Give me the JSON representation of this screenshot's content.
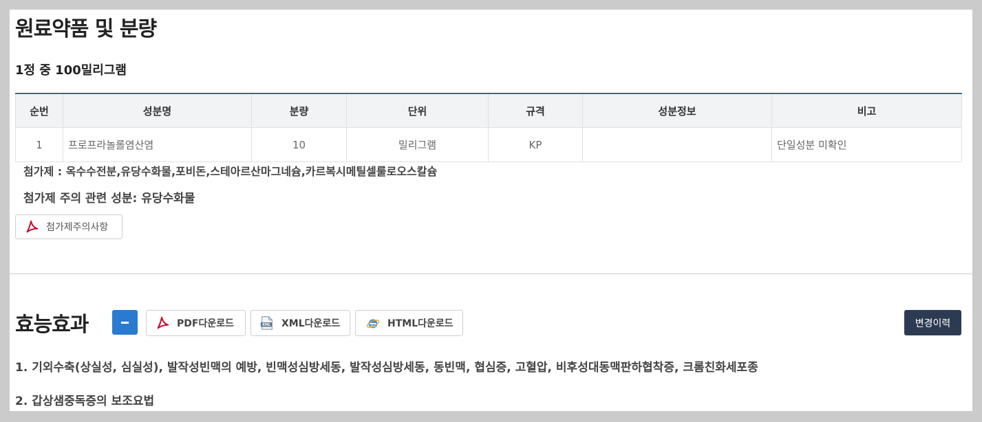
{
  "ingredients": {
    "title": "원료약품 및 분량",
    "subtitle": "1정 중 100밀리그램",
    "headers": [
      "순번",
      "성분명",
      "분량",
      "단위",
      "규격",
      "성분정보",
      "비고"
    ],
    "rows": [
      [
        "1",
        "프로프라놀롤염산염",
        "10",
        "밀리그램",
        "KP",
        "",
        "단일성분 미확인"
      ]
    ],
    "additives": "첨가제 : 옥수수전분,유당수화물,포비돈,스테아르산마그네슘,카르복시메틸셀룰로오스칼슘",
    "caution_related": "첨가제 주의 관련 성분: 유당수화물",
    "caution_button": "첨가제주의사항"
  },
  "efficacy": {
    "title": "효능효과",
    "pdf_button": "PDF다운로드",
    "xml_button": "XML다운로드",
    "html_button": "HTML다운로드",
    "history_button": "변경이력",
    "items": [
      "1. 기외수축(상실성, 심실성), 발작성빈맥의 예방, 빈맥성심방세동, 발작성심방세동, 동빈맥, 협심증, 고혈압, 비후성대동맥판하협착증, 크롬친화세포종",
      "2. 갑상샘중독증의 보조요법"
    ]
  },
  "colors": {
    "table_top_border": "#2c6e9e",
    "minus_button": "#2a7ad0",
    "history_button": "#2d3b52",
    "pdf_icon": "#c8102e"
  }
}
